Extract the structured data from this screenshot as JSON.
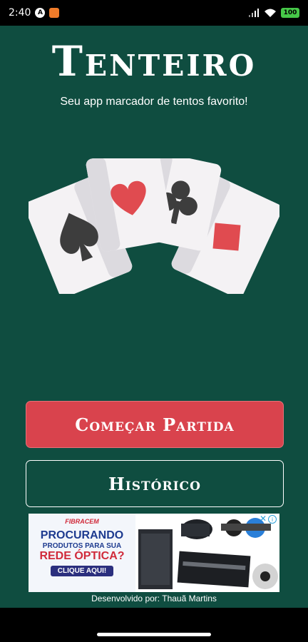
{
  "status_bar": {
    "time": "2:40",
    "notif_a": "A",
    "battery": "100",
    "icons": [
      "signal-icon",
      "wifi-icon",
      "battery-icon"
    ]
  },
  "app": {
    "title": "Tenteiro",
    "subtitle": "Seu app marcador de tentos favorito!",
    "cards": [
      "spade-card",
      "heart-card",
      "club-card",
      "diamond-card"
    ],
    "start_button": "Começar Partida",
    "history_button": "Histórico",
    "credit": "Desenvolvido por: Thauã Martins",
    "colors": {
      "background": "#0f4d40",
      "accent": "#d9434d",
      "card_red": "#e04b50",
      "card_dark": "#3d3d3d"
    }
  },
  "ad": {
    "brand": "FIBRACEM",
    "line1": "PROCURANDO",
    "line2": "PRODUTOS PARA SUA",
    "line3": "REDE ÓPTICA?",
    "cta": "CLIQUE AQUI!",
    "info": "i",
    "close": "✕"
  }
}
